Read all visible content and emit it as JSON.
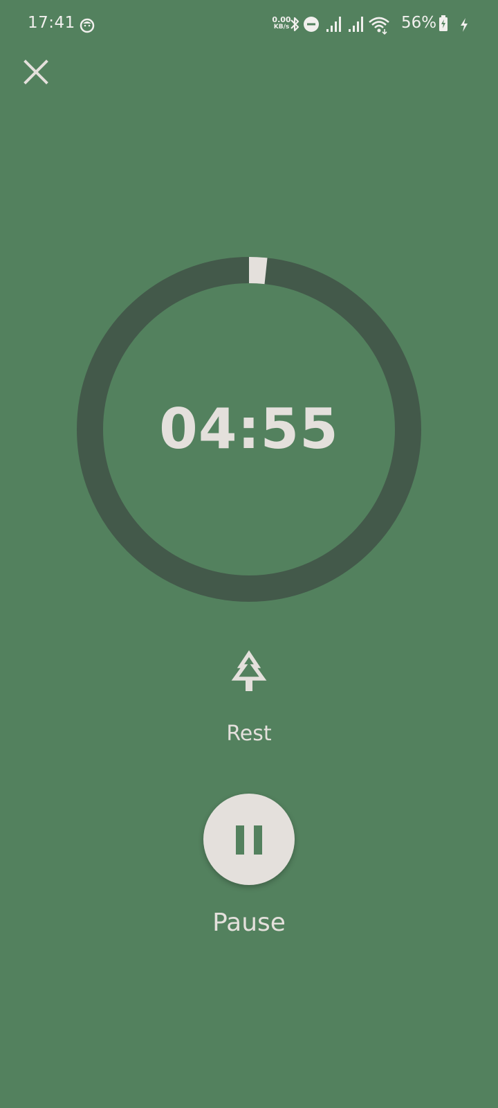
{
  "status_bar": {
    "time": "17:41",
    "net_speed_value": "0.00",
    "net_speed_unit": "KB/s",
    "battery_percent": "56%",
    "icons": [
      "notification-app-icon",
      "bluetooth-icon",
      "do-not-disturb-icon",
      "signal-icon",
      "signal-icon",
      "wifi-icon",
      "battery-icon",
      "charging-icon"
    ]
  },
  "timer": {
    "display": "04:55",
    "elapsed_fraction": 0.017
  },
  "mode": {
    "icon": "tree-icon",
    "label": "Rest"
  },
  "controls": {
    "pause_icon": "pause-icon",
    "pause_label": "Pause"
  },
  "colors": {
    "background": "#53815e",
    "ring_track": "#43594a",
    "ring_progress": "#e4e0dc",
    "foreground": "#e4e0dc"
  }
}
